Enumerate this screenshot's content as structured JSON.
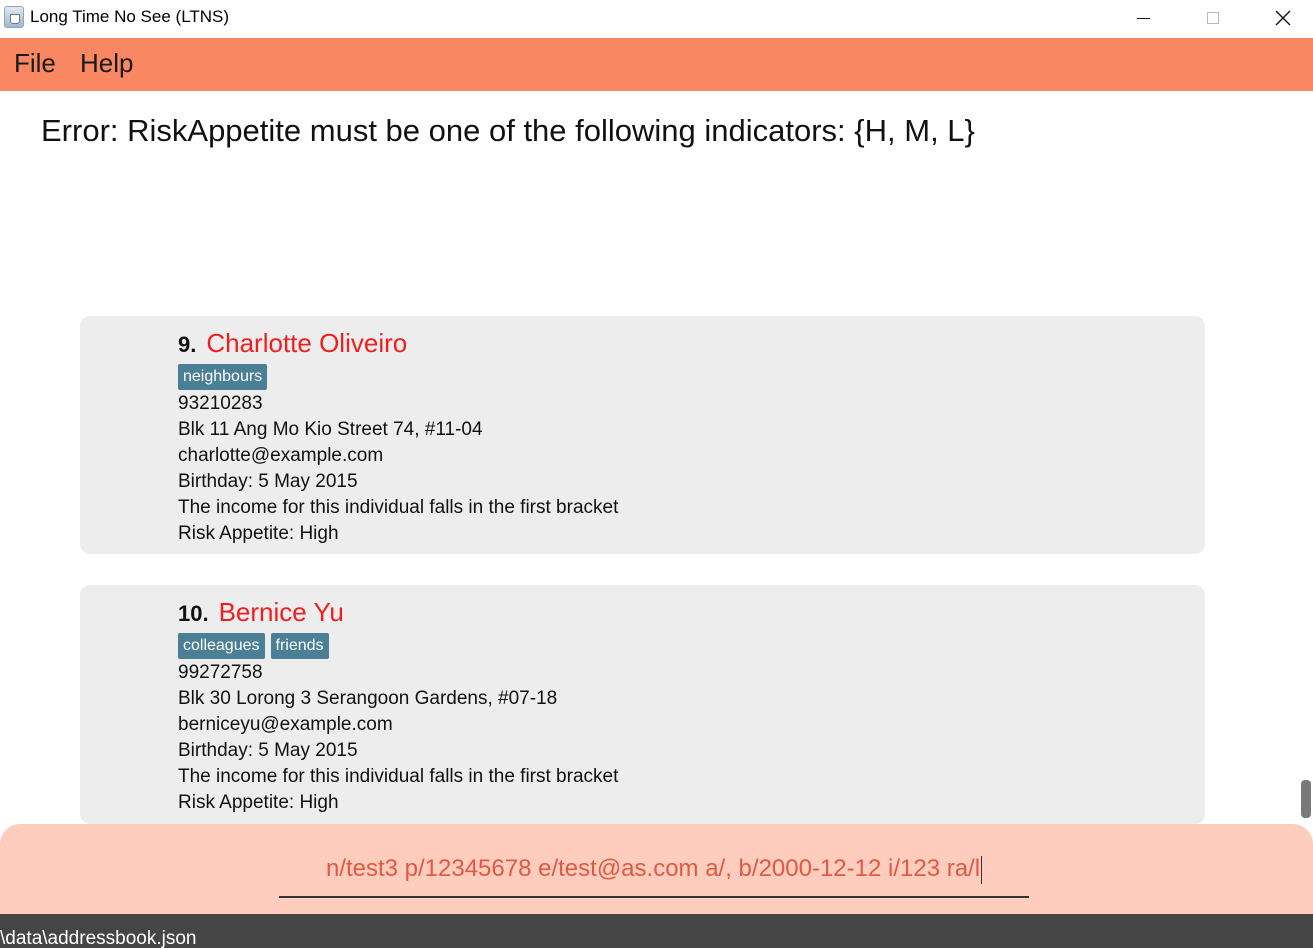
{
  "window": {
    "title": "Long Time No See (LTNS)"
  },
  "menu": {
    "file": "File",
    "help": "Help"
  },
  "result": {
    "message": "Error: RiskAppetite must be one of the following indicators: {H, M, L}"
  },
  "persons": [
    {
      "index": "9.",
      "name": "Charlotte Oliveiro",
      "tags": [
        "neighbours"
      ],
      "phone": "93210283",
      "address": "Blk 11 Ang Mo Kio Street 74, #11-04",
      "email": "charlotte@example.com",
      "birthday": "Birthday: 5 May 2015",
      "income": "The income for this individual falls in the first bracket",
      "risk": "Risk Appetite: High"
    },
    {
      "index": "10.",
      "name": "Bernice Yu",
      "tags": [
        "colleagues",
        "friends"
      ],
      "phone": "99272758",
      "address": "Blk 30 Lorong 3 Serangoon Gardens, #07-18",
      "email": "berniceyu@example.com",
      "birthday": "Birthday: 5 May 2015",
      "income": "The income for this individual falls in the first bracket",
      "risk": "Risk Appetite: High"
    }
  ],
  "command": {
    "value": "n/test3 p/12345678 e/test@as.com a/, b/2000-12-12 i/123 ra/l"
  },
  "status": {
    "path": "\\data\\addressbook.json"
  },
  "colors": {
    "menubar": "#f98762",
    "command_panel": "#fecdbd",
    "name": "#f01e1e",
    "tag": "#4a7f95",
    "statusbar": "#454545"
  }
}
